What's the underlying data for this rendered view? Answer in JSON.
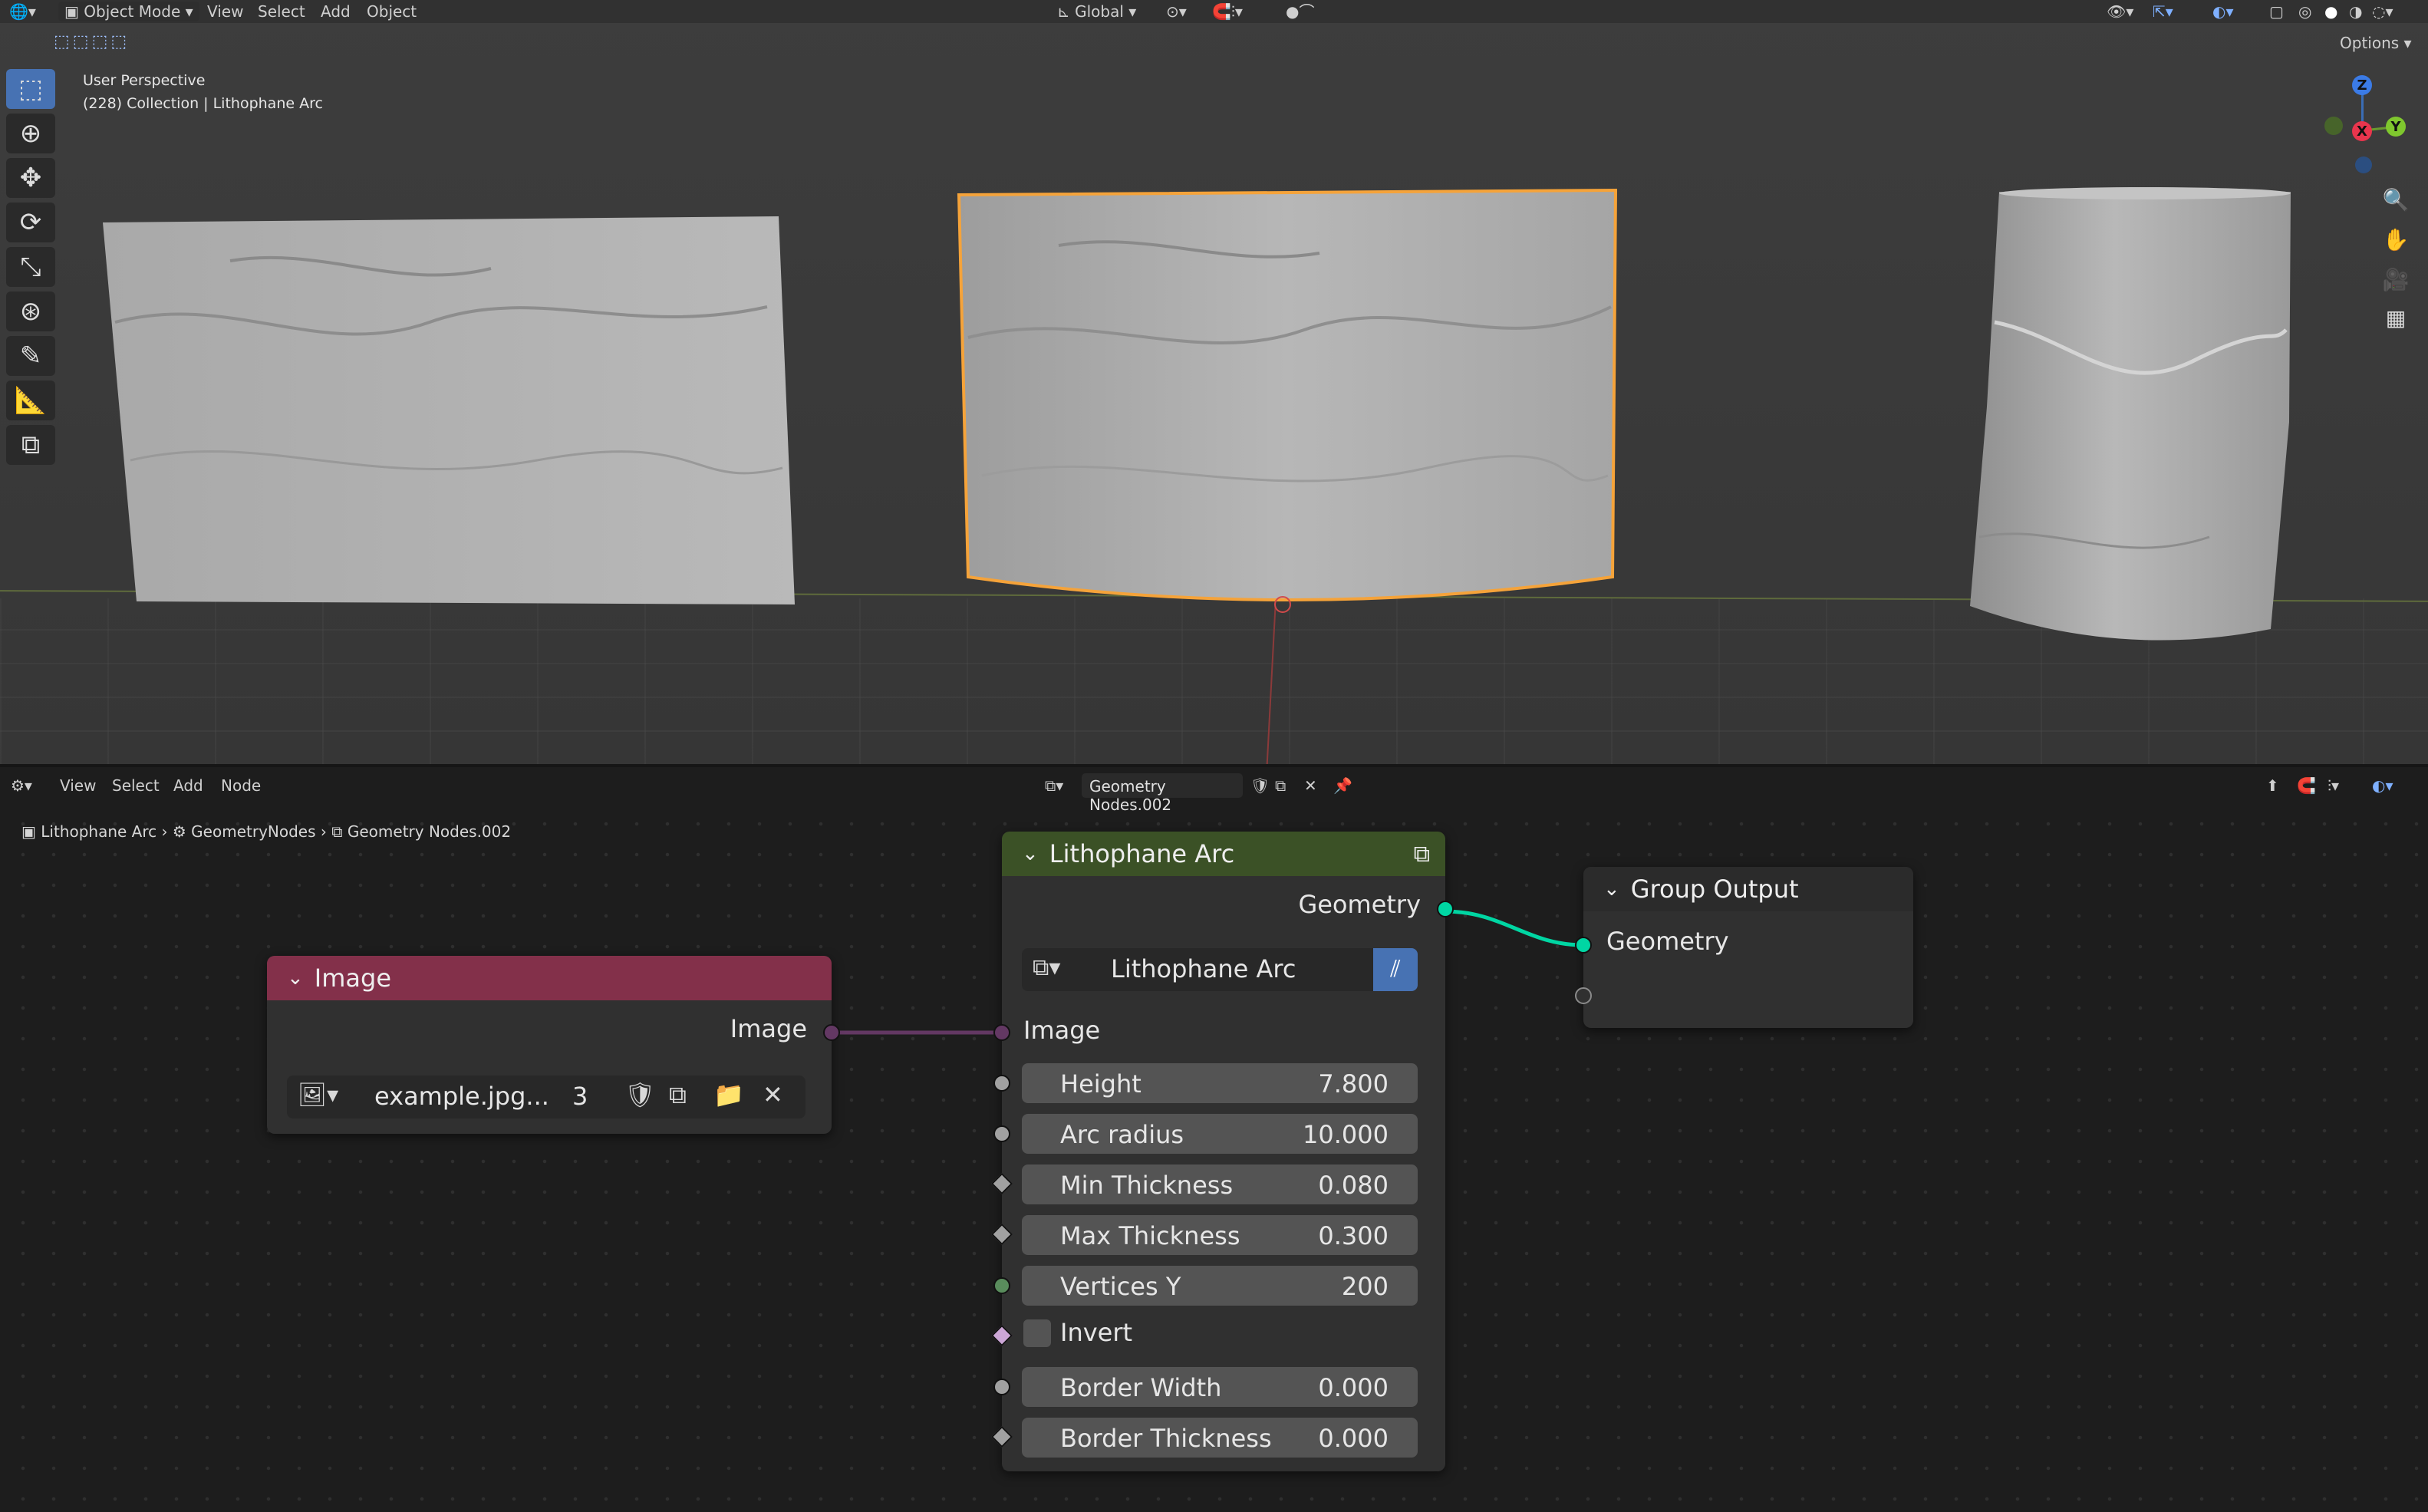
{
  "viewport": {
    "header": {
      "mode": "Object Mode",
      "menus": [
        "View",
        "Select",
        "Add",
        "Object"
      ],
      "orientation": "Global",
      "options": "Options"
    },
    "info_line1": "User Perspective",
    "info_line2": "(228) Collection | Lithophane Arc",
    "gizmo": {
      "z": "Z",
      "y": "Y",
      "x": "X"
    }
  },
  "node_editor": {
    "header": {
      "menus": [
        "View",
        "Select",
        "Add",
        "Node"
      ],
      "tree_name": "Geometry Nodes.002"
    },
    "breadcrumb": [
      "Lithophane Arc",
      "GeometryNodes",
      "Geometry Nodes.002"
    ],
    "image_node": {
      "title": "Image",
      "output": "Image",
      "file": "example.jpg...",
      "users": "3"
    },
    "group_node": {
      "title": "Lithophane Arc",
      "output": "Geometry",
      "group_name": "Lithophane Arc",
      "image_input": "Image",
      "fields": [
        {
          "label": "Height",
          "value": "7.800"
        },
        {
          "label": "Arc radius",
          "value": "10.000"
        },
        {
          "label": "Min Thickness",
          "value": "0.080"
        },
        {
          "label": "Max Thickness",
          "value": "0.300"
        },
        {
          "label": "Vertices Y",
          "value": "200"
        }
      ],
      "invert_label": "Invert",
      "invert_checked": false,
      "fields2": [
        {
          "label": "Border Width",
          "value": "0.000"
        },
        {
          "label": "Border Thickness",
          "value": "0.000"
        }
      ]
    },
    "output_node": {
      "title": "Group Output",
      "input": "Geometry"
    }
  },
  "colors": {
    "image_header": "#83304a",
    "group_header": "#3b5126",
    "output_header": "#2b2b2b",
    "geometry_socket": "#00d6a3",
    "image_socket": "#633863",
    "float_socket": "#a1a1a1",
    "int_socket": "#598c5c",
    "bool_socket": "#cca6d6",
    "selection": "#f5a33a",
    "accent": "#4772b3"
  }
}
